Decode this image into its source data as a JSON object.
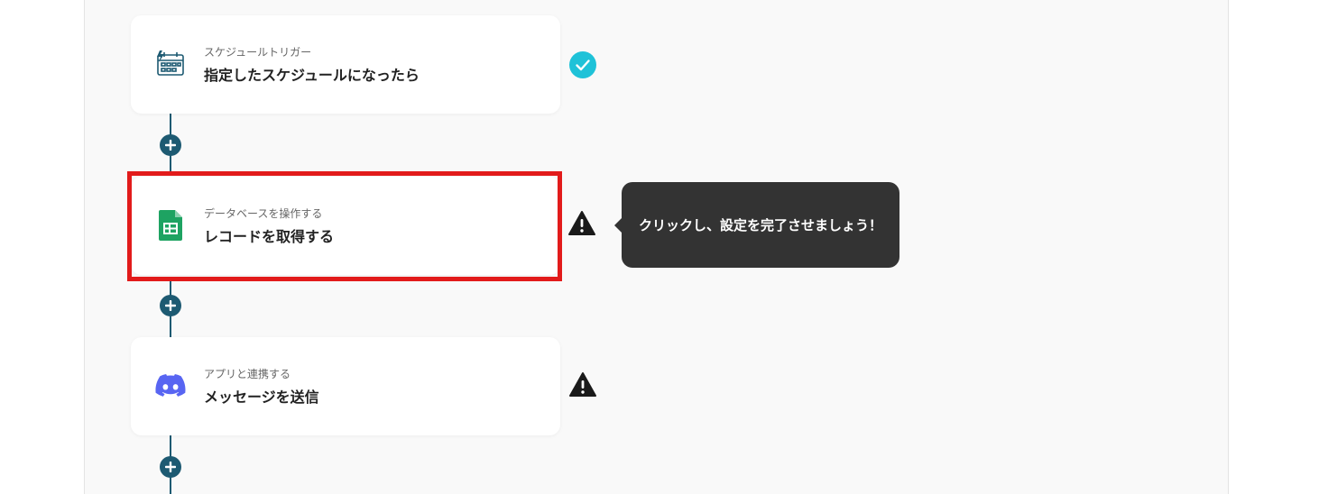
{
  "flow": {
    "steps": [
      {
        "subtitle": "スケジュールトリガー",
        "title": "指定したスケジュールになったら",
        "icon": "schedule-calendar-icon",
        "status": "complete"
      },
      {
        "subtitle": "データベースを操作する",
        "title": "レコードを取得する",
        "icon": "google-sheets-icon",
        "status": "warning"
      },
      {
        "subtitle": "アプリと連携する",
        "title": "メッセージを送信",
        "icon": "discord-icon",
        "status": "warning"
      }
    ],
    "tooltip": "クリックし、設定を完了させましょう！",
    "colors": {
      "connector": "#1d5a72",
      "check": "#1fc2d8",
      "highlight": "#e21b1b",
      "tooltip_bg": "#333333",
      "sheets_green": "#1ea362",
      "discord": "#5865f2"
    }
  }
}
